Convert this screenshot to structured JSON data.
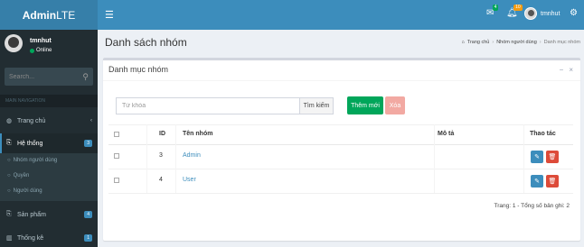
{
  "header": {
    "logo_prefix": "Admin",
    "logo_suffix": "LTE",
    "toggle_icon": "bars-icon",
    "mail_badge": "4",
    "bell_badge": "10",
    "user_name": "tmnhut"
  },
  "sidebar": {
    "user": {
      "name": "tmnhut",
      "status": "Online"
    },
    "search_placeholder": "Search...",
    "header_label": "MAIN NAVIGATION",
    "items": [
      {
        "label": "Trang chủ",
        "icon": "dashboard-icon"
      },
      {
        "label": "Hệ thống",
        "icon": "system-icon",
        "badge": "3"
      },
      {
        "label": "Sản phẩm",
        "icon": "products-icon",
        "badge": "4"
      },
      {
        "label": "Thống kê",
        "icon": "chart-icon",
        "badge": "1"
      }
    ],
    "submenu": [
      "Nhóm người dùng",
      "Quyền",
      "Người dùng"
    ]
  },
  "page": {
    "title": "Danh sách nhóm",
    "breadcrumb": [
      "Trang chủ",
      "Nhóm người dùng",
      "Danh mục nhóm"
    ]
  },
  "box": {
    "title": "Danh mục nhóm",
    "search_placeholder": "Từ khóa",
    "search_button": "Tìm kiếm",
    "add_button": "Thêm mới",
    "delete_button": "Xóa"
  },
  "table": {
    "headers": {
      "id": "ID",
      "name": "Tên nhóm",
      "desc": "Mô tả",
      "action": "Thao tác"
    },
    "rows": [
      {
        "id": "3",
        "name": "Admin",
        "desc": ""
      },
      {
        "id": "4",
        "name": "User",
        "desc": ""
      }
    ],
    "pager": "Trang: 1 - Tổng số bản ghi: 2"
  },
  "colors": {
    "header": "#3c8dbc",
    "logo": "#367fa9",
    "sidebar": "#222d32",
    "success": "#00a65a",
    "danger": "#dd4b39"
  }
}
